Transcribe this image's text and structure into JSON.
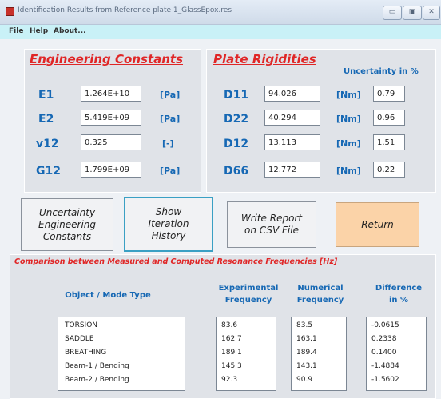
{
  "window": {
    "title": "Identification Results from Reference plate 1_GlassEpox.res",
    "controls": [
      "▭",
      "▣",
      "✕"
    ]
  },
  "menu": [
    "File",
    "Help",
    "About..."
  ],
  "engineering": {
    "title": "Engineering Constants",
    "rows": [
      {
        "label": "E1",
        "value": "1.264E+10",
        "unit": "[Pa]"
      },
      {
        "label": "E2",
        "value": "5.419E+09",
        "unit": "[Pa]"
      },
      {
        "label": "v12",
        "value": "0.325",
        "unit": "[-]"
      },
      {
        "label": "G12",
        "value": "1.799E+09",
        "unit": "[Pa]"
      }
    ]
  },
  "rigidities": {
    "title": "Plate Rigidities",
    "uncertainty_header": "Uncertainty in %",
    "rows": [
      {
        "label": "D11",
        "value": "94.026",
        "unit": "[Nm]",
        "uncertainty": "0.79"
      },
      {
        "label": "D22",
        "value": "40.294",
        "unit": "[Nm]",
        "uncertainty": "0.96"
      },
      {
        "label": "D12",
        "value": "13.113",
        "unit": "[Nm]",
        "uncertainty": "1.51"
      },
      {
        "label": "D66",
        "value": "12.772",
        "unit": "[Nm]",
        "uncertainty": "0.22"
      }
    ]
  },
  "buttons": {
    "uncertainty": "Uncertainty\nEngineering\nConstants",
    "iteration": "Show\nIteration\nHistory",
    "report": "Write Report\non CSV File",
    "return": "Return"
  },
  "comparison": {
    "title": "Comparison between Measured and Computed Resonance Frequencies [Hz]",
    "headers": {
      "mode": "Object / Mode Type",
      "experimental": "Experimental\nFrequency",
      "numerical": "Numerical\nFrequency",
      "difference": "Difference\nin %"
    },
    "modes": [
      "TORSION",
      "SADDLE",
      "BREATHING",
      "Beam-1 / Bending",
      "Beam-2 / Bending"
    ],
    "experimental": [
      "83.6",
      "162.7",
      "189.1",
      "145.3",
      "92.3"
    ],
    "numerical": [
      "83.5",
      "163.1",
      "189.4",
      "143.1",
      "90.9"
    ],
    "difference": [
      "-0.0615",
      "0.2338",
      "0.1400",
      "-1.4884",
      "-1.5602"
    ]
  },
  "colors": {
    "section_title": "#e02626",
    "label_blue": "#1668b4",
    "menubar": "#c9f1f7",
    "return_button": "#fbd3a8"
  }
}
